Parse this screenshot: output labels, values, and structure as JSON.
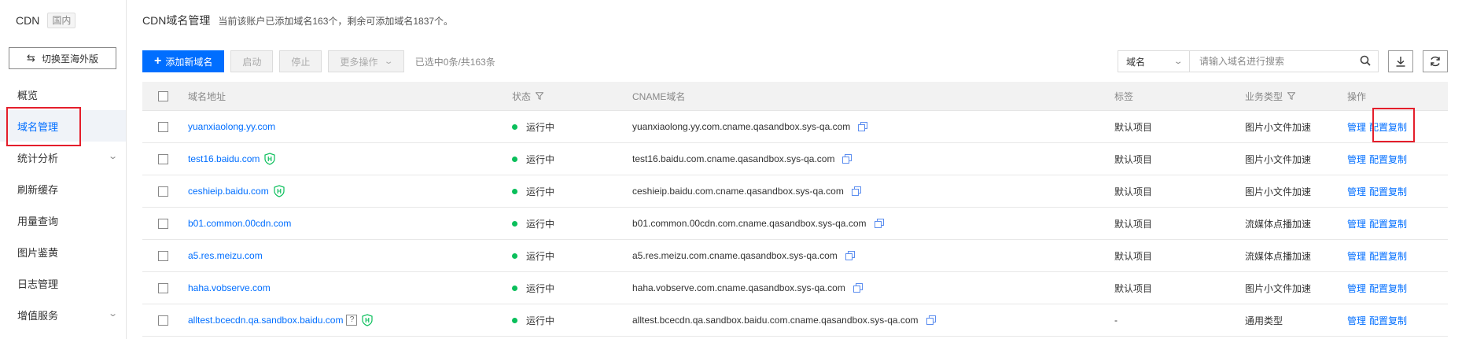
{
  "sidebar": {
    "product": "CDN",
    "region_badge": "国内",
    "switch_button": "切换至海外版",
    "items": [
      {
        "label": "概览",
        "active": false,
        "expandable": false
      },
      {
        "label": "域名管理",
        "active": true,
        "expandable": false
      },
      {
        "label": "统计分析",
        "active": false,
        "expandable": true
      },
      {
        "label": "刷新缓存",
        "active": false,
        "expandable": false
      },
      {
        "label": "用量查询",
        "active": false,
        "expandable": false
      },
      {
        "label": "图片鉴黄",
        "active": false,
        "expandable": false
      },
      {
        "label": "日志管理",
        "active": false,
        "expandable": false
      },
      {
        "label": "增值服务",
        "active": false,
        "expandable": true
      }
    ]
  },
  "header": {
    "title": "CDN域名管理",
    "description": "当前该账户已添加域名163个，剩余可添加域名1837个。"
  },
  "toolbar": {
    "add_label": "添加新域名",
    "start_label": "启动",
    "stop_label": "停止",
    "more_label": "更多操作",
    "selected_info": "已选中0条/共163条",
    "search_field": "域名",
    "search_placeholder": "请输入域名进行搜索"
  },
  "table": {
    "headers": {
      "domain": "域名地址",
      "status": "状态",
      "cname": "CNAME域名",
      "tag": "标签",
      "type": "业务类型",
      "ops": "操作"
    },
    "rows": [
      {
        "domain": "yuanxiaolong.yy.com",
        "shield": false,
        "help": false,
        "status": "运行中",
        "cname": "yuanxiaolong.yy.com.cname.qasandbox.sys-qa.com",
        "tag": "默认项目",
        "type": "图片小文件加速",
        "op_manage": "管理",
        "op_copy": "配置复制"
      },
      {
        "domain": "test16.baidu.com",
        "shield": true,
        "help": false,
        "status": "运行中",
        "cname": "test16.baidu.com.cname.qasandbox.sys-qa.com",
        "tag": "默认项目",
        "type": "图片小文件加速",
        "op_manage": "管理",
        "op_copy": "配置复制"
      },
      {
        "domain": "ceshieip.baidu.com",
        "shield": true,
        "help": false,
        "status": "运行中",
        "cname": "ceshieip.baidu.com.cname.qasandbox.sys-qa.com",
        "tag": "默认项目",
        "type": "图片小文件加速",
        "op_manage": "管理",
        "op_copy": "配置复制"
      },
      {
        "domain": "b01.common.00cdn.com",
        "shield": false,
        "help": false,
        "status": "运行中",
        "cname": "b01.common.00cdn.com.cname.qasandbox.sys-qa.com",
        "tag": "默认项目",
        "type": "流媒体点播加速",
        "op_manage": "管理",
        "op_copy": "配置复制"
      },
      {
        "domain": "a5.res.meizu.com",
        "shield": false,
        "help": false,
        "status": "运行中",
        "cname": "a5.res.meizu.com.cname.qasandbox.sys-qa.com",
        "tag": "默认项目",
        "type": "流媒体点播加速",
        "op_manage": "管理",
        "op_copy": "配置复制"
      },
      {
        "domain": "haha.vobserve.com",
        "shield": false,
        "help": false,
        "status": "运行中",
        "cname": "haha.vobserve.com.cname.qasandbox.sys-qa.com",
        "tag": "默认项目",
        "type": "图片小文件加速",
        "op_manage": "管理",
        "op_copy": "配置复制"
      },
      {
        "domain": "alltest.bcecdn.qa.sandbox.baidu.com",
        "shield": true,
        "help": true,
        "help_mark": "?",
        "status": "运行中",
        "cname": "alltest.bcecdn.qa.sandbox.baidu.com.cname.qasandbox.sys-qa.com",
        "tag": "-",
        "type": "通用类型",
        "op_manage": "管理",
        "op_copy": "配置复制"
      }
    ]
  },
  "colors": {
    "accent": "#006eff",
    "running": "#0abf5b",
    "highlight": "#e41e2b"
  }
}
